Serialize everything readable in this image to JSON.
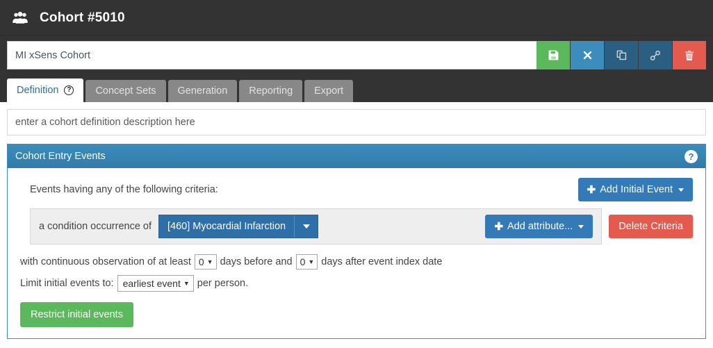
{
  "header": {
    "icon": "users-group-icon",
    "title": "Cohort #5010"
  },
  "toolbar": {
    "name_value": "MI xSens Cohort",
    "name_placeholder": "",
    "buttons": [
      {
        "name": "save-button",
        "icon": "floppy-disk-icon",
        "color": "#5cb85c"
      },
      {
        "name": "close-button",
        "icon": "close-x-icon",
        "color": "#3c8dbc"
      },
      {
        "name": "copy-button",
        "icon": "copy-icon",
        "color": "#2b5f82"
      },
      {
        "name": "link-button",
        "icon": "link-icon",
        "color": "#2b5f82"
      },
      {
        "name": "delete-button",
        "icon": "trash-icon",
        "color": "#e35b4f"
      }
    ]
  },
  "tabs": [
    {
      "label": "Definition",
      "active": true,
      "help": "?"
    },
    {
      "label": "Concept Sets",
      "active": false
    },
    {
      "label": "Generation",
      "active": false
    },
    {
      "label": "Reporting",
      "active": false
    },
    {
      "label": "Export",
      "active": false
    }
  ],
  "description": {
    "value": "",
    "placeholder": "enter a cohort definition description here"
  },
  "panel": {
    "title": "Cohort Entry Events",
    "help_icon": "?",
    "criteria_label": "Events having any of the following criteria:",
    "add_initial_event_label": "Add Initial Event",
    "criteria": {
      "prefix_text": "a condition occurrence of",
      "concept_value": "[460] Myocardial Infarction",
      "add_attribute_label": "Add attribute...",
      "delete_label": "Delete Criteria"
    },
    "observation": {
      "text_before": "with continuous observation of at least",
      "days_before_value": "0",
      "text_middle": "days before and",
      "days_after_value": "0",
      "text_after": "days after event index date"
    },
    "limit": {
      "text_before": "Limit initial events to:",
      "value": "earliest event",
      "text_after": "per person."
    },
    "restrict_label": "Restrict initial events"
  },
  "colors": {
    "header_bg": "#333333",
    "primary": "#337ab7",
    "panel_header": "#3c8dbc",
    "success": "#5cb85c",
    "danger": "#e35b4f",
    "concept_blue": "#2f6fa8"
  }
}
